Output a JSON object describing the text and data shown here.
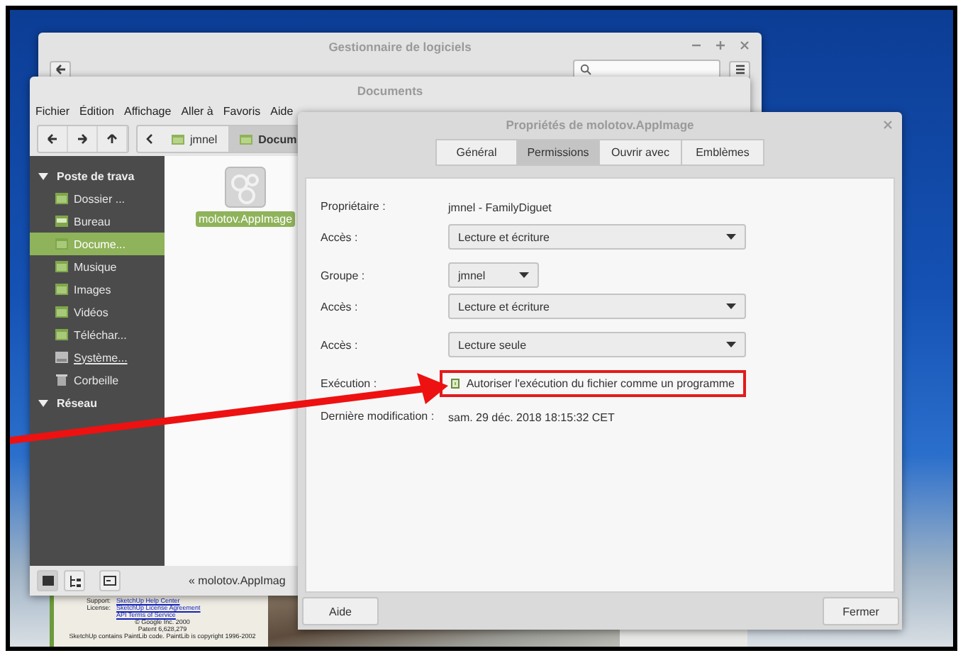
{
  "software_manager": {
    "title": "Gestionnaire de logiciels"
  },
  "file_manager": {
    "title": "Documents",
    "menu": [
      "Fichier",
      "Édition",
      "Affichage",
      "Aller à",
      "Favoris",
      "Aide"
    ],
    "path": [
      {
        "label": "jmnel",
        "selected": false
      },
      {
        "label": "Docum",
        "selected": true
      }
    ],
    "sidebar": [
      {
        "label": "Poste de trava",
        "expanded": true,
        "children": [
          {
            "label": "Dossier ...",
            "kind": "folder",
            "selected": false
          },
          {
            "label": "Bureau",
            "kind": "desktop",
            "selected": false
          },
          {
            "label": "Docume...",
            "kind": "folder",
            "selected": true
          },
          {
            "label": "Musique",
            "kind": "folder",
            "selected": false
          },
          {
            "label": "Images",
            "kind": "folder",
            "selected": false
          },
          {
            "label": "Vidéos",
            "kind": "folder",
            "selected": false
          },
          {
            "label": "Téléchar...",
            "kind": "folder",
            "selected": false
          },
          {
            "label": "Système...",
            "kind": "drive",
            "selected": false
          },
          {
            "label": "Corbeille",
            "kind": "trash",
            "selected": false
          }
        ]
      },
      {
        "label": "Réseau",
        "expanded": true
      }
    ],
    "files": [
      {
        "name": "molotov.AppImage",
        "selected": true
      }
    ],
    "status": "« molotov.AppImag"
  },
  "sketchup": {
    "lines": [
      {
        "label": "Support:",
        "link": "SketchUp Help Center"
      },
      {
        "label": "License:",
        "link": "SketchUp License Agreement"
      },
      {
        "link": "API Terms of Service"
      }
    ],
    "notes": [
      "© Google Inc. 2000",
      "Patent 6,628,279",
      "SketchUp contains PaintLib code. PaintLib is copyright 1996-2002"
    ]
  },
  "properties": {
    "title": "Propriétés de molotov.AppImage",
    "tabs": [
      {
        "label": "Général",
        "selected": false
      },
      {
        "label": "Permissions",
        "selected": true
      },
      {
        "label": "Ouvrir avec",
        "selected": false
      },
      {
        "label": "Emblèmes",
        "selected": false
      }
    ],
    "sections": [
      [
        {
          "kind": "text",
          "label": "Propriétaire :",
          "value": "jmnel - FamilyDiguet"
        },
        {
          "kind": "dropdown",
          "label": "Accès :",
          "value": "Lecture et écriture"
        }
      ],
      [
        {
          "kind": "combo",
          "label": "Groupe :",
          "value": "jmnel"
        },
        {
          "kind": "dropdown",
          "label": "Accès :",
          "value": "Lecture et écriture"
        }
      ],
      [
        {
          "kind": "dropdown",
          "label": "Accès :",
          "value": "Lecture seule"
        }
      ],
      [
        {
          "kind": "checkbox",
          "label": "Exécution :",
          "value": "Autoriser l'exécution du fichier comme un programme",
          "checked": true,
          "highlighted": true
        },
        {
          "kind": "text",
          "label": "Dernière modification :",
          "value": "sam. 29 déc. 2018 18:15:32 CET"
        }
      ]
    ],
    "buttons": [
      "Aide",
      "Fermer"
    ]
  }
}
